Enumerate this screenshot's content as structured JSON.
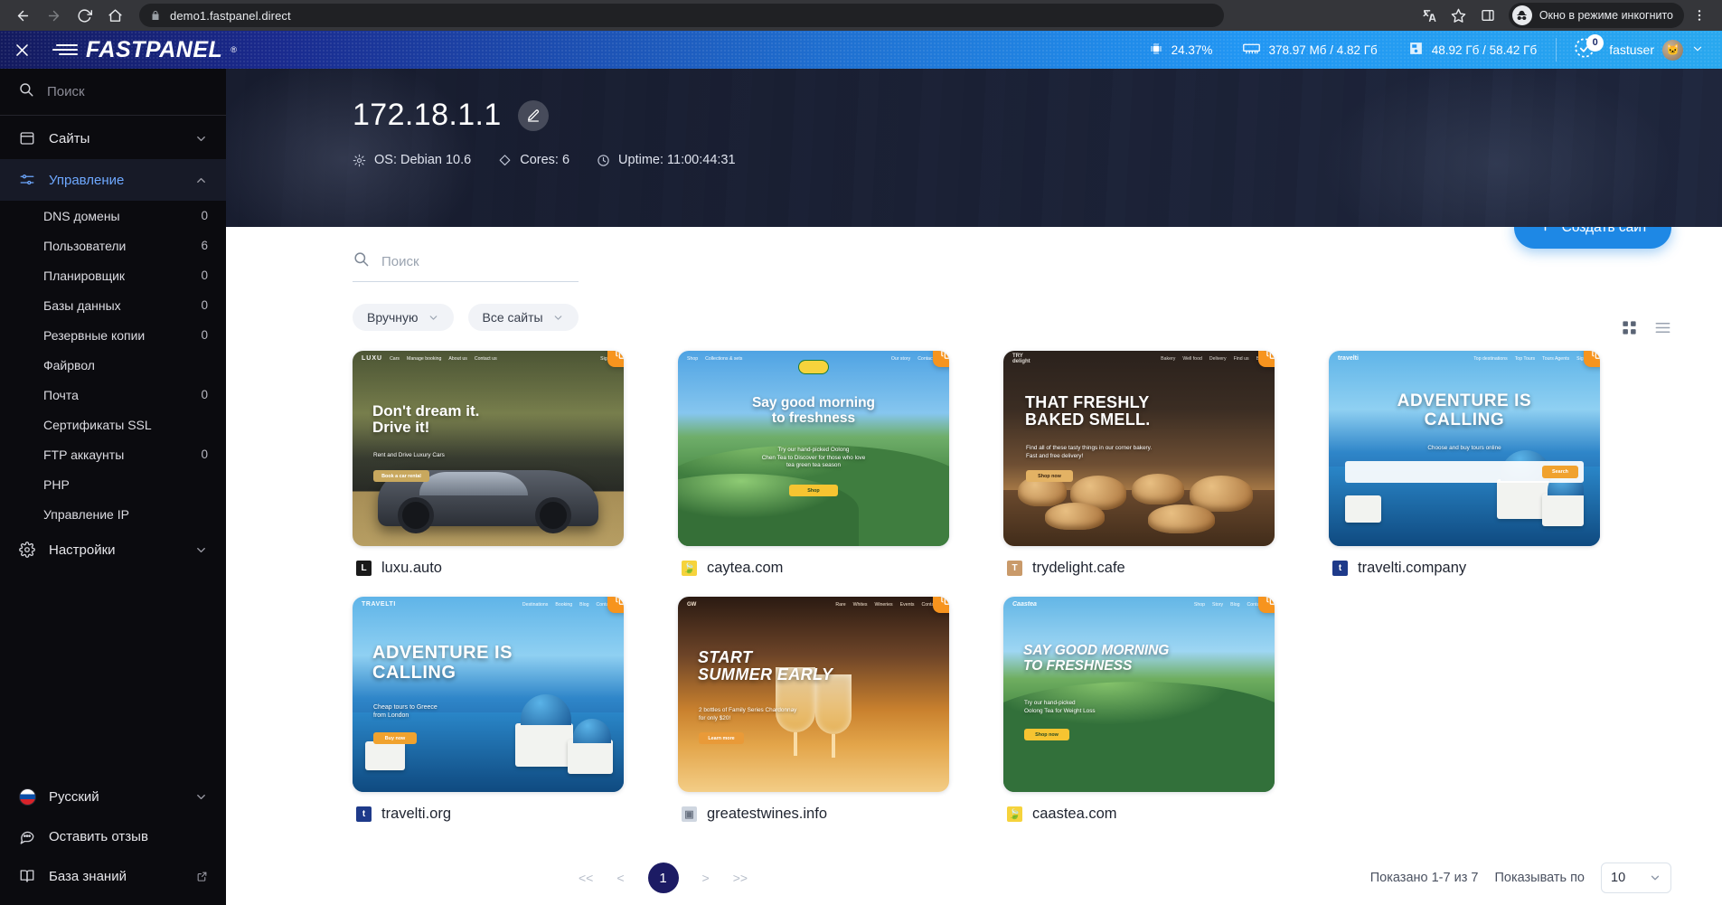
{
  "browser": {
    "url": "demo1.fastpanel.direct",
    "incognito_label": "Окно в режиме инкогнито",
    "back_icon": "back-arrow-icon",
    "forward_icon": "forward-arrow-icon",
    "reload_icon": "reload-icon",
    "home_icon": "home-icon",
    "lock_icon": "lock-icon",
    "translate_icon": "translate-icon",
    "bookmark_icon": "star-icon",
    "sidepanel_icon": "side-panel-icon",
    "menu_icon": "three-dots-menu-icon"
  },
  "topbar": {
    "close_icon": "close-icon",
    "brand": "FASTPANEL",
    "brand_reg": "®",
    "stats": [
      {
        "icon": "cpu-icon",
        "value": "24.37%"
      },
      {
        "icon": "ram-icon",
        "value": "378.97 Мб / 4.82 Гб"
      },
      {
        "icon": "disk-icon",
        "value": "48.92 Гб / 58.42 Гб"
      }
    ],
    "notifications": {
      "icon": "notification-check-icon",
      "count": "0"
    },
    "user": {
      "name": "fastuser",
      "avatar_icon": "user-avatar",
      "chevron": "chevron-down-icon"
    }
  },
  "sidebar": {
    "search_placeholder": "Поиск",
    "search_icon": "search-icon",
    "items": [
      {
        "label": "Сайты",
        "icon": "window-icon",
        "chevron": "chevron-down-icon",
        "active": false
      },
      {
        "label": "Управление",
        "icon": "sliders-icon",
        "chevron": "chevron-up-icon",
        "active": true
      }
    ],
    "sub_items": [
      {
        "label": "DNS домены",
        "count": "0"
      },
      {
        "label": "Пользователи",
        "count": "6"
      },
      {
        "label": "Планировщик",
        "count": "0"
      },
      {
        "label": "Базы данных",
        "count": "0"
      },
      {
        "label": "Резервные копии",
        "count": "0"
      },
      {
        "label": "Файрвол",
        "count": ""
      },
      {
        "label": "Почта",
        "count": "0"
      },
      {
        "label": "Сертификаты SSL",
        "count": ""
      },
      {
        "label": "FTP аккаунты",
        "count": "0"
      },
      {
        "label": "PHP",
        "count": ""
      },
      {
        "label": "Управление IP",
        "count": ""
      }
    ],
    "settings": {
      "label": "Настройки",
      "icon": "gear-icon",
      "chevron": "chevron-down-icon"
    },
    "bottom": [
      {
        "label": "Русский",
        "icon": "flag-ru-icon",
        "chevron": "chevron-down-icon"
      },
      {
        "label": "Оставить отзыв",
        "icon": "feedback-icon",
        "chevron": ""
      },
      {
        "label": "База знаний",
        "icon": "book-icon",
        "chevron": "external-link-icon"
      }
    ]
  },
  "hero": {
    "title": "172.18.1.1",
    "edit_icon": "edit-pencil-icon",
    "meta": [
      {
        "icon": "gear-icon",
        "text": "OS: Debian 10.6"
      },
      {
        "icon": "diamond-icon",
        "text": "Cores: 6"
      },
      {
        "icon": "clock-icon",
        "text": "Uptime: 11:00:44:31"
      }
    ]
  },
  "main": {
    "create_button": {
      "label": "Создать сайт",
      "icon": "plus-icon"
    },
    "search_placeholder": "Поиск",
    "search_icon": "search-icon",
    "filters": [
      {
        "label": "Вручную",
        "chevron": "chevron-down-icon"
      },
      {
        "label": "Все сайты",
        "chevron": "chevron-down-icon"
      }
    ],
    "view_grid_icon": "grid-view-icon",
    "view_list_icon": "list-view-icon",
    "sites": [
      {
        "name": "luxu.auto",
        "favicon_letter": "L",
        "favicon_color": "#1a1a1a",
        "favicon_text_color": "#ffffff",
        "copy_icon": "copy-icon",
        "nav": [
          "Cars",
          "Manage booking",
          "About us",
          "Contact us"
        ],
        "nav_right": "Sign in",
        "headline": "Don't dream it.\nDrive it!",
        "sub": "Rent and Drive Luxury Cars",
        "cta": "Book a car rental"
      },
      {
        "name": "caytea.com",
        "favicon_letter": "🍃",
        "favicon_color": "#f6d33c",
        "favicon_text_color": "#1a7a3a",
        "copy_icon": "copy-icon",
        "nav": [
          "Shop",
          "Collections & sets",
          "Story",
          "Our story",
          "Contact us"
        ],
        "nav_right": "",
        "headline": "Say good morning\nto freshness",
        "sub": "Try our hand-picked Oolong\nChen Tea to Discover for those who love\ntea green tea season",
        "cta": "Shop"
      },
      {
        "name": "trydelight.cafe",
        "favicon_letter": "T",
        "favicon_color": "#c99a6a",
        "favicon_text_color": "#ffffff",
        "copy_icon": "copy-icon",
        "nav": [
          "Bakery",
          "Well food",
          "Delivery",
          "Find us",
          "Blog"
        ],
        "nav_right": "",
        "headline": "THAT FRESHLY\nBAKED SMELL.",
        "sub": "Find all of these tasty things in our corner bakery.\nFast and free delivery!",
        "cta": "Shop now"
      },
      {
        "name": "travelti.company",
        "favicon_letter": "t",
        "favicon_color": "#1e3a8a",
        "favicon_text_color": "#ffffff",
        "copy_icon": "copy-icon",
        "nav": [
          "Top destinations",
          "Top Tours",
          "Tours Agents"
        ],
        "nav_right": "Sign in",
        "brand": "travelti",
        "headline": "ADVENTURE IS\nCALLING",
        "sub": "Choose and buy tours online",
        "cta": "Search"
      },
      {
        "name": "travelti.org",
        "favicon_letter": "t",
        "favicon_color": "#1e3a8a",
        "favicon_text_color": "#ffffff",
        "copy_icon": "copy-icon",
        "nav": [
          "Destinations",
          "Booking",
          "Blog",
          "Contacts"
        ],
        "nav_right": "",
        "brand": "TRAVELTI",
        "headline": "ADVENTURE IS\nCALLING",
        "sub": "Cheap tours to Greece\nfrom London",
        "cta": "Buy now"
      },
      {
        "name": "greatestwines.info",
        "favicon_letter": "▣",
        "favicon_color": "#cfd6e0",
        "favicon_text_color": "#6b7483",
        "copy_icon": "copy-icon",
        "nav": [
          "Rare",
          "Whites",
          "Wineries",
          "Events",
          "Contacts"
        ],
        "nav_right": "",
        "headline": "START\nSUMMER EARLY",
        "sub": "2 bottles of Family Series Chardonnay\nfor only $20!",
        "cta": "Learn more"
      },
      {
        "name": "caastea.com",
        "favicon_letter": "🍃",
        "favicon_color": "#f6d33c",
        "favicon_text_color": "#1a7a3a",
        "copy_icon": "copy-icon",
        "nav": [
          "Shop",
          "Story",
          "Blog",
          "Contacts"
        ],
        "nav_right": "",
        "brand": "Caastea",
        "headline": "SAY GOOD MORNING\nTO FRESHNESS",
        "sub": "Try our hand-picked\nOolong Tea for Weight Loss",
        "cta": "Shop now"
      }
    ]
  },
  "footer": {
    "first_label": "<<",
    "prev_label": "<",
    "current_page": "1",
    "next_label": ">",
    "last_label": ">>",
    "shown_text": "Показано 1-7 из 7",
    "per_page_label": "Показывать по",
    "per_page_value": "10",
    "per_page_chevron": "chevron-down-icon"
  }
}
